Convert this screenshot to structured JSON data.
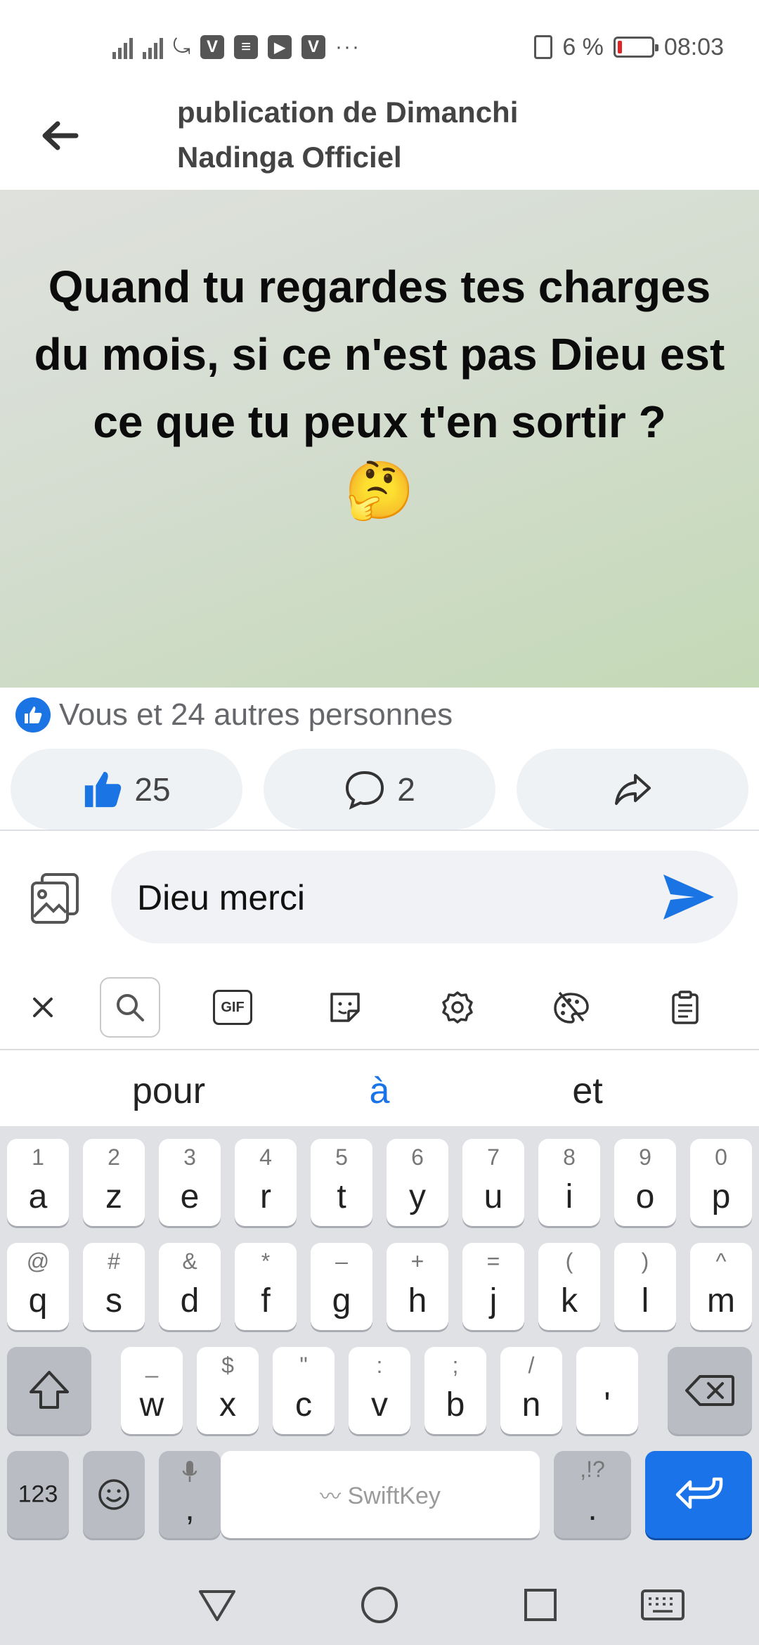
{
  "status_bar": {
    "battery_percent": "6 %",
    "time": "08:03",
    "app_icons": [
      "v-app-icon",
      "messages-icon",
      "youtube-icon",
      "v-app-icon"
    ],
    "app_icon_labels": [
      "V",
      "≡",
      "▶",
      "V"
    ],
    "more": "···"
  },
  "header": {
    "title_line1": "publication de Dimanchi",
    "title_line2": "Nadinga Officiel"
  },
  "post": {
    "text": "Quand tu regardes tes charges du mois, si ce n'est pas Dieu est ce que tu peux t'en sortir ?",
    "emoji": "🤔"
  },
  "reactions": {
    "summary": "Vous et 24 autres personnes",
    "like_count": "25",
    "comment_count": "2"
  },
  "comment": {
    "value": "Dieu merci"
  },
  "keyboard": {
    "toolbar": [
      "close-icon",
      "search-icon",
      "gif-icon",
      "sticker-icon",
      "settings-icon",
      "themes-icon",
      "clipboard-icon"
    ],
    "gif_label": "GIF",
    "suggestions": [
      "pour",
      "à",
      "et"
    ],
    "row1": [
      {
        "sec": "1",
        "pri": "a"
      },
      {
        "sec": "2",
        "pri": "z"
      },
      {
        "sec": "3",
        "pri": "e"
      },
      {
        "sec": "4",
        "pri": "r"
      },
      {
        "sec": "5",
        "pri": "t"
      },
      {
        "sec": "6",
        "pri": "y"
      },
      {
        "sec": "7",
        "pri": "u"
      },
      {
        "sec": "8",
        "pri": "i"
      },
      {
        "sec": "9",
        "pri": "o"
      },
      {
        "sec": "0",
        "pri": "p"
      }
    ],
    "row2": [
      {
        "sec": "@",
        "pri": "q"
      },
      {
        "sec": "#",
        "pri": "s"
      },
      {
        "sec": "&",
        "pri": "d"
      },
      {
        "sec": "*",
        "pri": "f"
      },
      {
        "sec": "–",
        "pri": "g"
      },
      {
        "sec": "+",
        "pri": "h"
      },
      {
        "sec": "=",
        "pri": "j"
      },
      {
        "sec": "(",
        "pri": "k"
      },
      {
        "sec": ")",
        "pri": "l"
      },
      {
        "sec": "^",
        "pri": "m"
      }
    ],
    "row3": [
      {
        "sec": "_",
        "pri": "w"
      },
      {
        "sec": "$",
        "pri": "x"
      },
      {
        "sec": "\"",
        "pri": "c"
      },
      {
        "sec": ":",
        "pri": "v"
      },
      {
        "sec": ";",
        "pri": "b"
      },
      {
        "sec": "/",
        "pri": "n"
      },
      {
        "sec": "",
        "pri": "'"
      }
    ],
    "numbers_label": "123",
    "comma_label": ",",
    "space_label": "SwiftKey",
    "period_sec": ",!?",
    "period_label": "."
  },
  "colors": {
    "facebook_blue": "#1b74e4",
    "keyboard_blue": "#1a73e8"
  }
}
